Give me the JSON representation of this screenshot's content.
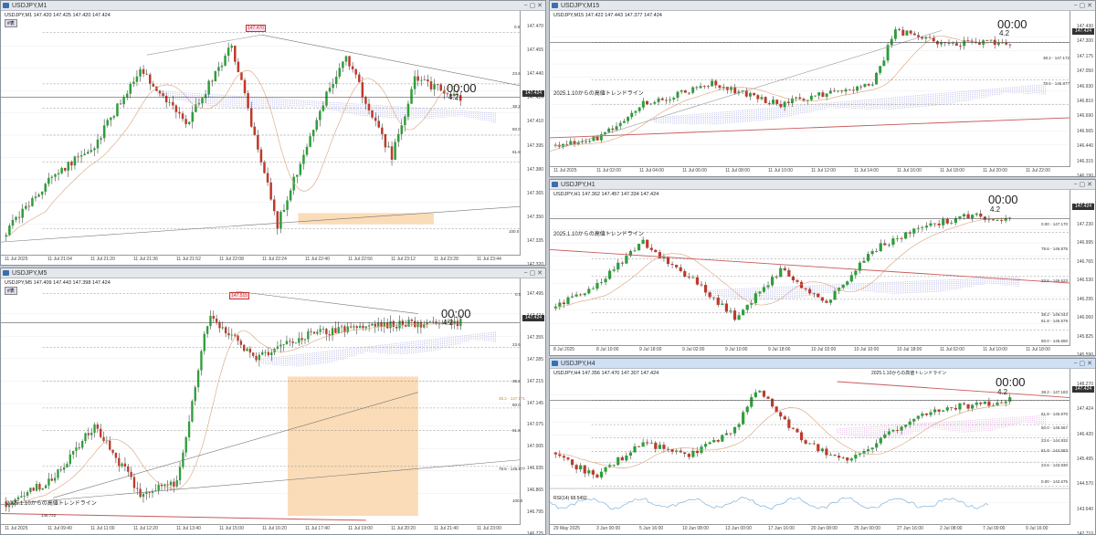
{
  "windows": {
    "m1": {
      "title": "USDJPY,M1",
      "info": "USDJPY,M1  147.420 147.425 147.420 147.424",
      "badge": "#表",
      "timer": "00:00",
      "timer_price": "4.2",
      "current_price": "147.424",
      "hi_label": "147.470",
      "fib_labels": [
        "0.0",
        "23.6",
        "38.2",
        "50.0",
        "61.8",
        "100.0"
      ],
      "price_axis": [
        "147.470",
        "147.455",
        "147.440",
        "147.424",
        "147.410",
        "147.395",
        "147.380",
        "147.365",
        "147.350",
        "147.335",
        "147.320"
      ],
      "time_axis": [
        "11 Jul 2025",
        "11 Jul 21:04",
        "11 Jul 21:20",
        "11 Jul 21:36",
        "11 Jul 21:52",
        "11 Jul 22:08",
        "11 Jul 22:24",
        "11 Jul 22:40",
        "11 Jul 22:56",
        "11 Jul 23:12",
        "11 Jul 23:28",
        "11 Jul 23:44"
      ]
    },
    "m5": {
      "title": "USDJPY,M5",
      "info": "USDJPY,M5  147.409 147.443 147.398 147.424",
      "badge": "#表",
      "timer": "00:00",
      "timer_price": "4.2",
      "current_price": "147.424",
      "hi_label": "147.515",
      "trend_label": "2025.1.10からの高値トレンドライン",
      "fib_labels": [
        "0.0",
        "23.6",
        "38.2",
        "38.2 - 147.171",
        "50.0",
        "61.8",
        "78.6 - 146.877",
        "100.0",
        "146.722"
      ],
      "price_axis": [
        "147.495",
        "147.424",
        "147.355",
        "147.285",
        "147.215",
        "147.145",
        "147.075",
        "147.005",
        "146.935",
        "146.865",
        "146.795",
        "146.725"
      ],
      "time_axis": [
        "11 Jul 2025",
        "11 Jul 09:40",
        "11 Jul 11:00",
        "11 Jul 12:20",
        "11 Jul 13:40",
        "11 Jul 15:00",
        "11 Jul 16:20",
        "11 Jul 17:40",
        "11 Jul 19:00",
        "11 Jul 20:20",
        "11 Jul 21:40",
        "11 Jul 23:00"
      ]
    },
    "m15": {
      "title": "USDJPY,M15",
      "info": "USDJPY,M15  147.422 147.443 147.377 147.424",
      "timer": "00:00",
      "timer_price": "4.2",
      "current_price": "147.424",
      "trend_label": "2025.1.10からの高値トレンドライン",
      "fib_labels": [
        "38.2 - 147.172",
        "78.6 - 146.877"
      ],
      "price_axis": [
        "147.430",
        "147.300",
        "147.175",
        "147.050",
        "146.930",
        "146.810",
        "146.690",
        "146.565",
        "146.440",
        "146.315",
        "146.190"
      ],
      "time_axis": [
        "11 Jul 2025",
        "11 Jul 02:00",
        "11 Jul 04:00",
        "11 Jul 06:00",
        "11 Jul 08:00",
        "11 Jul 10:00",
        "11 Jul 12:00",
        "11 Jul 14:00",
        "11 Jul 16:00",
        "11 Jul 18:00",
        "11 Jul 20:00",
        "11 Jul 22:00"
      ]
    },
    "h1": {
      "title": "USDJPY,H1",
      "info": "USDJPY,H1  147.362 147.457 147.334 147.424",
      "timer": "00:00",
      "timer_price": "4.2",
      "current_price": "147.424",
      "trend_label": "2025.1.10からの高値トレンドライン",
      "fib_labels": [
        "0.00 - 147.170",
        "78.6 - 146.875",
        "23.6 - 146.623",
        "38.2 - 146.043",
        "61.8 - 145.579",
        "50.0 - 145.650"
      ],
      "price_axis": [
        "147.430",
        "147.230",
        "146.995",
        "146.765",
        "146.530",
        "146.295",
        "146.060",
        "145.825",
        "145.590"
      ],
      "time_axis": [
        "8 Jul 2025",
        "8 Jul 10:00",
        "9 Jul 18:00",
        "9 Jul 02:00",
        "9 Jul 10:00",
        "9 Jul 18:00",
        "10 Jul 02:00",
        "10 Jul 10:00",
        "10 Jul 18:00",
        "11 Jul 02:00",
        "11 Jul 10:00",
        "11 Jul 18:00"
      ]
    },
    "h4": {
      "title": "USDJPY,H4",
      "info": "USDJPY,H4  147.356 147.470 147.307 147.424",
      "timer": "00:00",
      "timer_price": "4.2",
      "current_price": "147.424",
      "trend_label": "2025.1.10からの高値トレンドライン",
      "rsi_label": "RSI(14) 68.5492",
      "fib_labels": [
        "38.2 - 147.183",
        "61.8 - 145.970",
        "50.0 - 145.567",
        "23.6 - 144.932",
        "61.8 - 144.583",
        "23.6 - 143.930",
        "0.00 - 142.675"
      ],
      "price_axis": [
        "148.270",
        "147.424",
        "146.420",
        "145.495",
        "144.570",
        "143.640",
        "142.710"
      ],
      "time_axis": [
        "29 May 2025",
        "3 Jun 00:00",
        "5 Jun 16:00",
        "10 Jun 08:00",
        "13 Jun 00:00",
        "17 Jun 16:00",
        "20 Jun 08:00",
        "25 Jun 00:00",
        "27 Jun 16:00",
        "2 Jul 08:00",
        "7 Jul 00:00",
        "9 Jul 16:00"
      ]
    }
  },
  "colors": {
    "bull": "#2e9e3a",
    "bear": "#c0392b",
    "cloud_blue": "#8b8fd8",
    "cloud_pink": "#d78ad7",
    "fib_zone": "#f9d3a6",
    "trendline": "#c85a5a"
  }
}
